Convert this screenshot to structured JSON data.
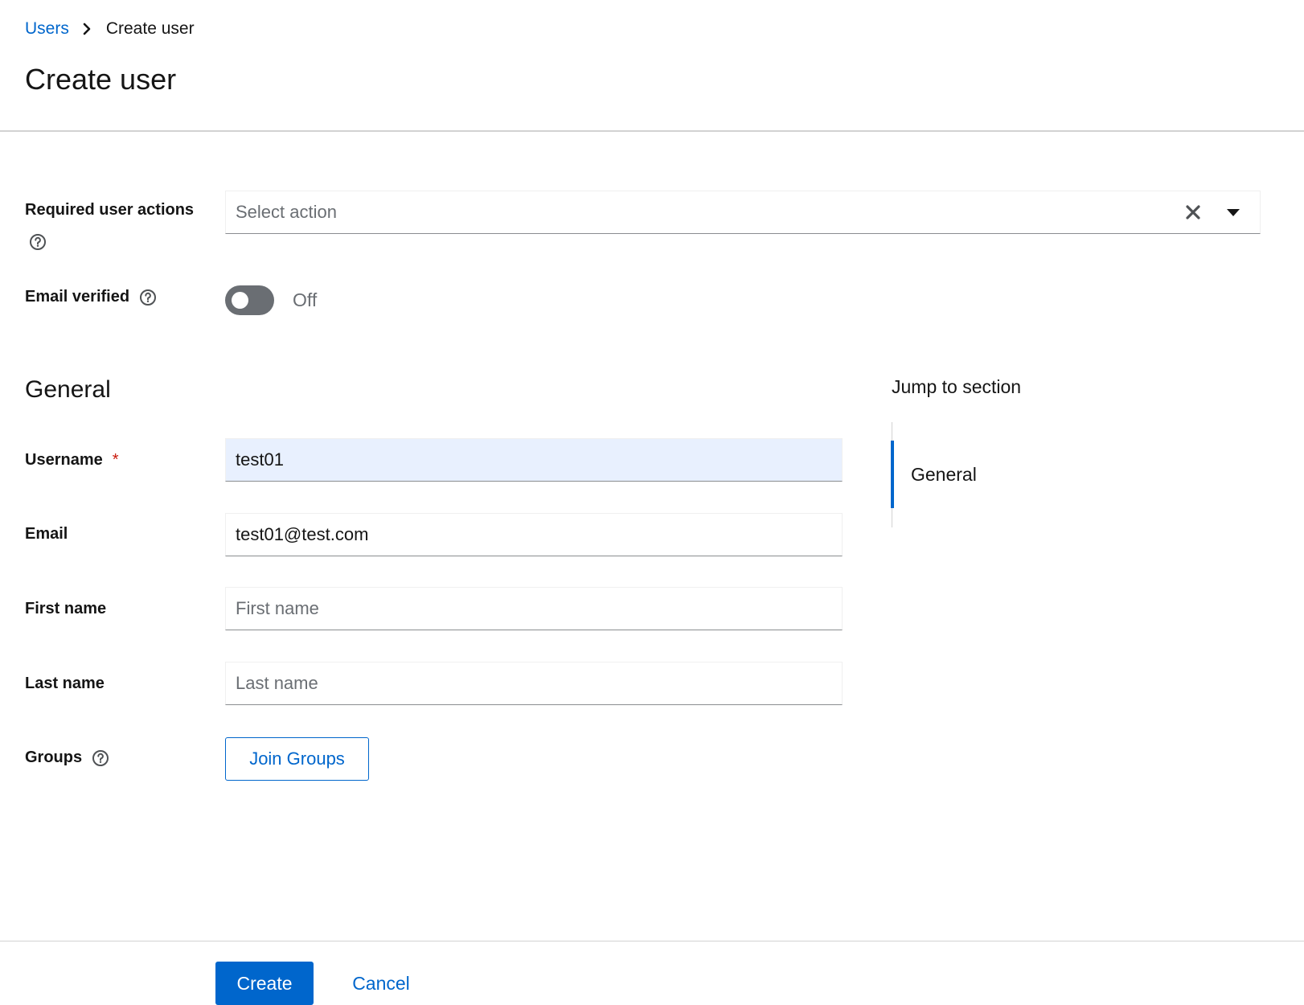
{
  "breadcrumb": {
    "parent": "Users",
    "current": "Create user"
  },
  "page": {
    "title": "Create user"
  },
  "required_actions": {
    "label": "Required user actions",
    "placeholder": "Select action",
    "icons": [
      "help-icon",
      "clear-icon",
      "caret-down-icon"
    ]
  },
  "email_verified": {
    "label": "Email verified",
    "toggle_state": "Off",
    "enabled": false
  },
  "general": {
    "section_title": "General",
    "username": {
      "label": "Username",
      "required_marker": "*",
      "value": "test01"
    },
    "email": {
      "label": "Email",
      "value": "test01@test.com"
    },
    "first_name": {
      "label": "First name",
      "placeholder": "First name",
      "value": ""
    },
    "last_name": {
      "label": "Last name",
      "placeholder": "Last name",
      "value": ""
    },
    "groups": {
      "label": "Groups",
      "button_label": "Join Groups"
    }
  },
  "jump_to_section": {
    "title": "Jump to section",
    "items": [
      "General"
    ],
    "active_item": "General"
  },
  "footer": {
    "create_label": "Create",
    "cancel_label": "Cancel"
  },
  "colors": {
    "accent": "#0066cc",
    "danger": "#c9190b",
    "toggle_off": "#6a6e73",
    "autofill_bg": "#e8f0fe"
  }
}
